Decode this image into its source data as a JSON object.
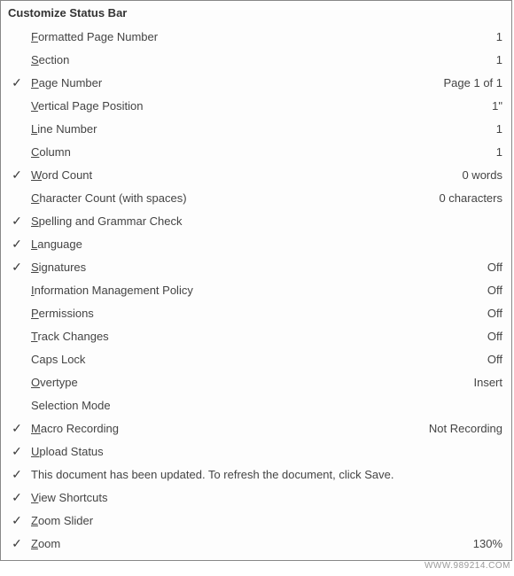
{
  "title": "Customize Status Bar",
  "items": [
    {
      "checked": false,
      "accel": "F",
      "rest": "ormatted Page Number",
      "value": "1"
    },
    {
      "checked": false,
      "accel": "S",
      "rest": "ection",
      "value": "1"
    },
    {
      "checked": true,
      "accel": "P",
      "rest": "age Number",
      "value": "Page 1 of 1"
    },
    {
      "checked": false,
      "accel": "V",
      "rest": "ertical Page Position",
      "value": "1\""
    },
    {
      "checked": false,
      "accel": "L",
      "rest": "ine Number",
      "value": "1"
    },
    {
      "checked": false,
      "accel": "C",
      "rest": "olumn",
      "value": "1"
    },
    {
      "checked": true,
      "accel": "W",
      "rest": "ord Count",
      "value": "0 words"
    },
    {
      "checked": false,
      "accel": "C",
      "rest": "haracter Count (with spaces)",
      "value": "0 characters"
    },
    {
      "checked": true,
      "accel": "S",
      "rest": "pelling and Grammar Check",
      "value": ""
    },
    {
      "checked": true,
      "accel": "L",
      "rest": "anguage",
      "value": ""
    },
    {
      "checked": true,
      "accel": "S",
      "rest": "ignatures",
      "value": "Off"
    },
    {
      "checked": false,
      "accel": "I",
      "rest": "nformation Management Policy",
      "value": "Off"
    },
    {
      "checked": false,
      "accel": "P",
      "rest": "ermissions",
      "value": "Off"
    },
    {
      "checked": false,
      "accel": "T",
      "rest": "rack Changes",
      "value": "Off"
    },
    {
      "checked": false,
      "accel": "",
      "rest": "Caps Lock",
      "value": "Off"
    },
    {
      "checked": false,
      "accel": "O",
      "rest": "vertype",
      "value": "Insert"
    },
    {
      "checked": false,
      "accel": "",
      "rest": "Selection Mode",
      "value": ""
    },
    {
      "checked": true,
      "accel": "M",
      "rest": "acro Recording",
      "value": "Not Recording"
    },
    {
      "checked": true,
      "accel": "U",
      "rest": "pload Status",
      "value": ""
    },
    {
      "checked": true,
      "accel": "",
      "rest": "This document has been updated. To refresh the document, click Save.",
      "value": ""
    },
    {
      "checked": true,
      "accel": "V",
      "rest": "iew Shortcuts",
      "value": ""
    },
    {
      "checked": true,
      "accel": "Z",
      "rest": "oom Slider",
      "value": ""
    },
    {
      "checked": true,
      "accel": "Z",
      "rest": "oom",
      "value": "130%"
    }
  ],
  "watermark": "WWW.989214.COM"
}
